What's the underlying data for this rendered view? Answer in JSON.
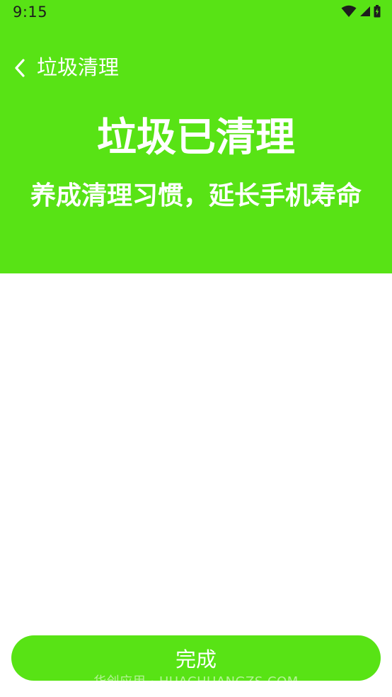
{
  "status_bar": {
    "time": "9:15"
  },
  "toolbar": {
    "title": "垃圾清理",
    "back_icon": "chevron-left-icon"
  },
  "hero": {
    "title": "垃圾已清理",
    "subtitle": "养成清理习惯，延长手机寿命"
  },
  "actions": {
    "done_label": "完成"
  },
  "watermark": {
    "text": "华创应用 · HUACHUANGZS.COM"
  },
  "colors": {
    "accent_green": "#58e315",
    "white": "#ffffff",
    "status_text": "#1d1d1d"
  }
}
